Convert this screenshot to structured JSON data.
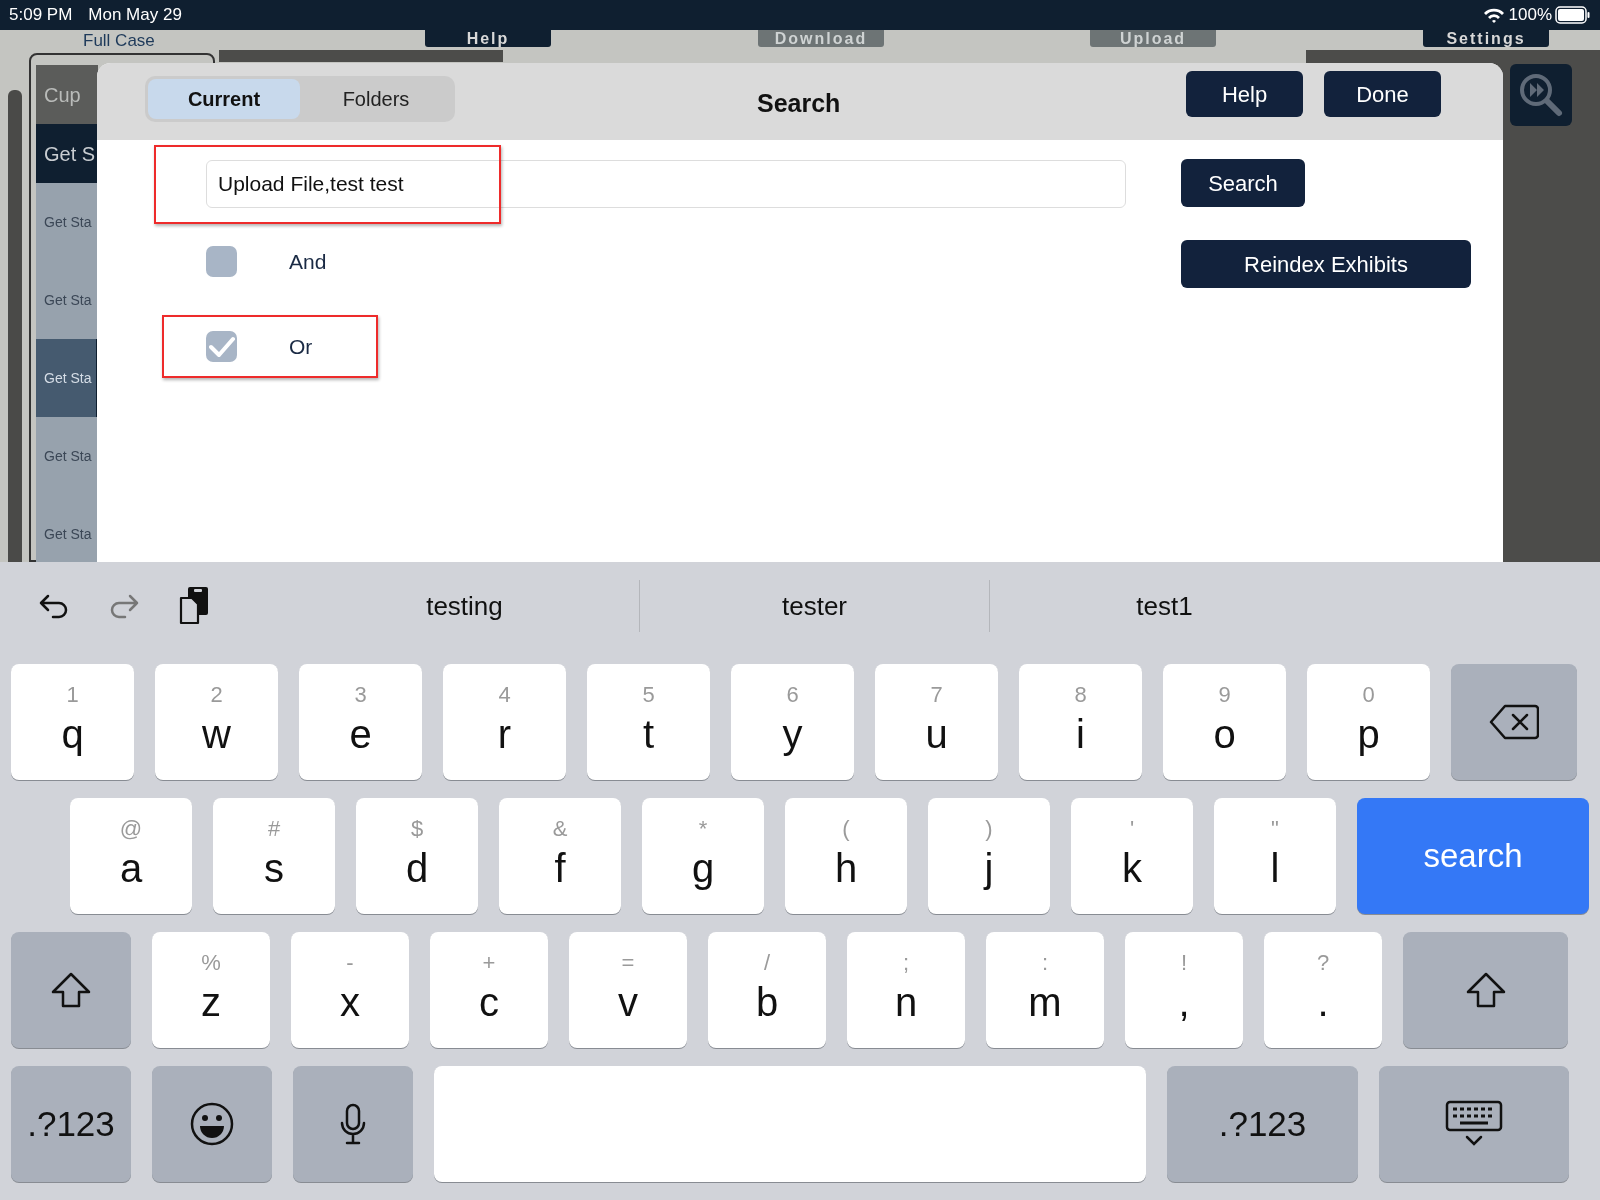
{
  "status_bar": {
    "time": "5:09 PM",
    "date": "Mon May 29",
    "battery": "100%"
  },
  "background": {
    "case_tab": "Full Case",
    "toolbar": [
      {
        "label": "Help",
        "highlighted": true
      },
      {
        "label": "Download",
        "highlighted": false
      },
      {
        "label": "Upload",
        "highlighted": false
      },
      {
        "label": "Settings",
        "highlighted": true
      }
    ],
    "sidebar": [
      {
        "kind": "case",
        "label": "Cup",
        "selected": false
      },
      {
        "kind": "section",
        "label": "Get S",
        "selected": false
      },
      {
        "kind": "item",
        "label": "Get Sta",
        "selected": false
      },
      {
        "kind": "item",
        "label": "Get Sta",
        "selected": false
      },
      {
        "kind": "item",
        "label": "Get Sta",
        "selected": true
      },
      {
        "kind": "item",
        "label": "Get Sta",
        "selected": false
      },
      {
        "kind": "item",
        "label": "Get Sta",
        "selected": false
      }
    ]
  },
  "dialog": {
    "title": "Search",
    "segments": [
      {
        "label": "Current",
        "selected": true
      },
      {
        "label": "Folders",
        "selected": false
      }
    ],
    "header_buttons": [
      "Help",
      "Done"
    ],
    "search_field": {
      "value": "Upload File,test test",
      "annotated": true
    },
    "options": [
      {
        "label": "And",
        "checked": false,
        "annotated": false
      },
      {
        "label": "Or",
        "checked": true,
        "annotated": true
      }
    ],
    "buttons": [
      "Search",
      "Reindex Exhibits"
    ]
  },
  "keyboard": {
    "suggestions": [
      "testing",
      "tester",
      "test1"
    ],
    "rows": [
      {
        "keys": [
          {
            "kind": "char",
            "label": "q",
            "alt": "1"
          },
          {
            "kind": "char",
            "label": "w",
            "alt": "2"
          },
          {
            "kind": "char",
            "label": "e",
            "alt": "3"
          },
          {
            "kind": "char",
            "label": "r",
            "alt": "4"
          },
          {
            "kind": "char",
            "label": "t",
            "alt": "5"
          },
          {
            "kind": "char",
            "label": "y",
            "alt": "6"
          },
          {
            "kind": "char",
            "label": "u",
            "alt": "7"
          },
          {
            "kind": "char",
            "label": "i",
            "alt": "8"
          },
          {
            "kind": "char",
            "label": "o",
            "alt": "9"
          },
          {
            "kind": "char",
            "label": "p",
            "alt": "0"
          },
          {
            "kind": "delete"
          }
        ]
      },
      {
        "keys": [
          {
            "kind": "char",
            "label": "a",
            "alt": "@"
          },
          {
            "kind": "char",
            "label": "s",
            "alt": "#"
          },
          {
            "kind": "char",
            "label": "d",
            "alt": "$"
          },
          {
            "kind": "char",
            "label": "f",
            "alt": "&"
          },
          {
            "kind": "char",
            "label": "g",
            "alt": "*"
          },
          {
            "kind": "char",
            "label": "h",
            "alt": "("
          },
          {
            "kind": "char",
            "label": "j",
            "alt": ")"
          },
          {
            "kind": "char",
            "label": "k",
            "alt": "'"
          },
          {
            "kind": "char",
            "label": "l",
            "alt": "\""
          },
          {
            "kind": "action",
            "label": "search"
          }
        ]
      },
      {
        "keys": [
          {
            "kind": "shift"
          },
          {
            "kind": "char",
            "label": "z",
            "alt": "%"
          },
          {
            "kind": "char",
            "label": "x",
            "alt": "-"
          },
          {
            "kind": "char",
            "label": "c",
            "alt": "+"
          },
          {
            "kind": "char",
            "label": "v",
            "alt": "="
          },
          {
            "kind": "char",
            "label": "b",
            "alt": "/"
          },
          {
            "kind": "char",
            "label": "n",
            "alt": ";"
          },
          {
            "kind": "char",
            "label": "m",
            "alt": ":"
          },
          {
            "kind": "char",
            "label": ",",
            "alt": "!"
          },
          {
            "kind": "char",
            "label": ".",
            "alt": "?"
          },
          {
            "kind": "shift"
          }
        ]
      },
      {
        "keys": [
          {
            "kind": "mode",
            "label": ".?123"
          },
          {
            "kind": "emoji"
          },
          {
            "kind": "mic"
          },
          {
            "kind": "space"
          },
          {
            "kind": "mode",
            "label": ".?123"
          },
          {
            "kind": "hide"
          }
        ]
      }
    ]
  }
}
